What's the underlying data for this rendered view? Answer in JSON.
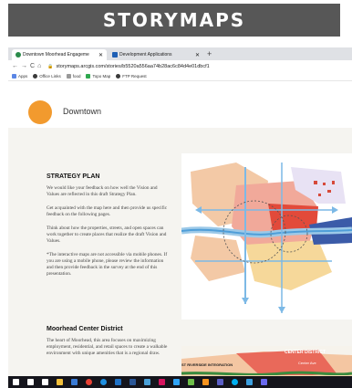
{
  "banner": {
    "title": "STORYMAPS"
  },
  "browser": {
    "tabs": [
      {
        "label": "Downtown Moorhead Engageme",
        "active": true,
        "color": "#2a8a4a"
      },
      {
        "label": "Development Applications",
        "active": false,
        "color": "#1e5fb4"
      }
    ],
    "url": "storymaps.arcgis.com/stories/b5520a556aa74b28ac6c84d4e01dbcf1",
    "bookmarks": [
      {
        "label": "Apps",
        "color": "#5b86e5"
      },
      {
        "label": "Office Links",
        "color": "#3a3a3a"
      },
      {
        "label": "food",
        "color": "#999999"
      },
      {
        "label": "Topo Map",
        "color": "#2fa84f"
      },
      {
        "label": "FTP Request",
        "color": "#3a3a3a"
      }
    ]
  },
  "story": {
    "title": "Downtown",
    "accent": "#f29a2e",
    "sections": [
      {
        "heading": "STRATEGY PLAN",
        "paragraphs": [
          "We would like your feedback on how well the Vision and Values are reflected in this draft Strategy Plan.",
          "Get acquainted with the map here and then provide us specific feedback on the following pages.",
          "Think about how the properties, streets, and open spaces can work together to create places that realize the draft Vision and Values.",
          "*The interactive maps are not accessible via mobile phones. If you are using a mobile phone, please review the information and then provide feedback in the survey at the end of this presentation."
        ]
      },
      {
        "heading": "Moorhead Center District",
        "paragraphs": [
          "The heart of Moorhead, this area focuses on maximizing employment, residential, and retail spaces to create a walkable environment with unique amenities that is a regional draw."
        ]
      }
    ]
  },
  "map2_labels": {
    "district": "CENTER DISTRICT",
    "riverside": "ST RIVERSIDE INTEGRATION",
    "street": "Center Ave",
    "mixed": "DOWNTOWN MIXED USE"
  },
  "taskbar": {
    "icons": [
      {
        "name": "windows-start-icon",
        "color": "#ffffff"
      },
      {
        "name": "search-icon",
        "color": "#ffffff"
      },
      {
        "name": "task-view-icon",
        "color": "#ffffff"
      },
      {
        "name": "file-explorer-icon",
        "color": "#f3c03b"
      },
      {
        "name": "store-icon",
        "color": "#3a7bd5"
      },
      {
        "name": "chrome-icon",
        "color": "#e94235"
      },
      {
        "name": "edge-icon",
        "color": "#1f8fe0"
      },
      {
        "name": "outlook-icon",
        "color": "#2072c6"
      },
      {
        "name": "word-icon",
        "color": "#2b5797"
      },
      {
        "name": "arcgis-icon",
        "color": "#4aa0d8"
      },
      {
        "name": "indesign-icon",
        "color": "#d6145f"
      },
      {
        "name": "photoshop-icon",
        "color": "#2fa3f7"
      },
      {
        "name": "maps-icon",
        "color": "#6fbf4a"
      },
      {
        "name": "illustrator-icon",
        "color": "#f7931e"
      },
      {
        "name": "teams-icon",
        "color": "#5b5fc7"
      },
      {
        "name": "skype-icon",
        "color": "#00aff0"
      },
      {
        "name": "notepad-icon",
        "color": "#3da0e0"
      },
      {
        "name": "app-icon",
        "color": "#6a6af0"
      }
    ]
  }
}
